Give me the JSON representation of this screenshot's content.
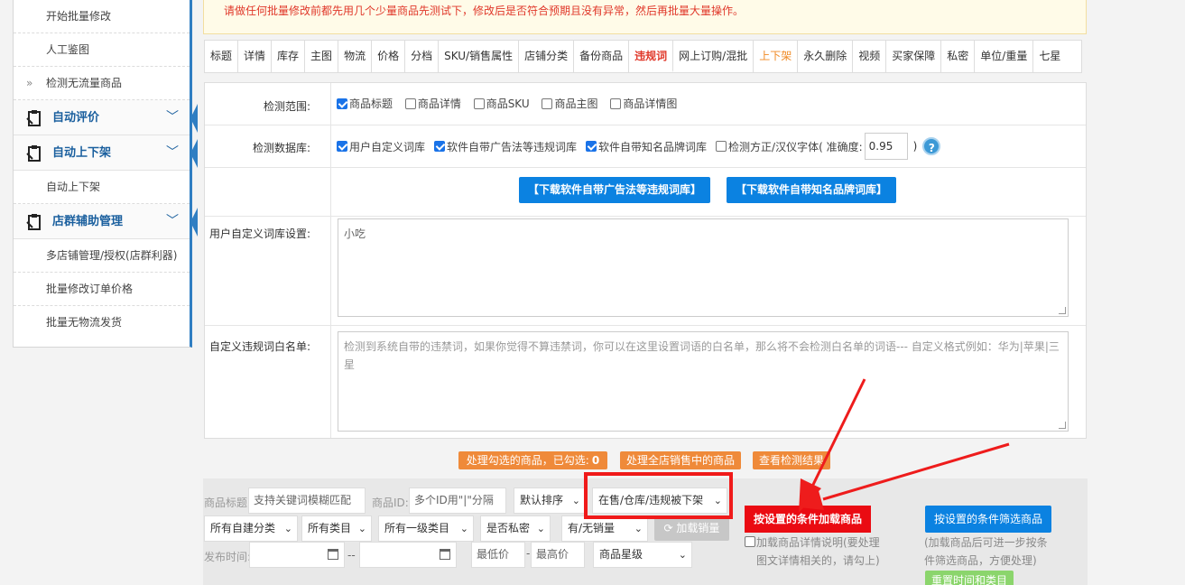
{
  "sidebar": {
    "items": [
      {
        "type": "sub",
        "label": "开始批量修改"
      },
      {
        "type": "sub",
        "label": "人工鉴图"
      },
      {
        "type": "sub",
        "label": "检测无流量商品",
        "chevron": "»"
      },
      {
        "type": "group",
        "label": "自动评价",
        "icon": "clipboard-icon"
      },
      {
        "type": "group",
        "label": "自动上下架",
        "icon": "clipboard-icon"
      },
      {
        "type": "sub",
        "label": "自动上下架"
      },
      {
        "type": "group",
        "label": "店群辅助管理",
        "icon": "clipboard-icon"
      },
      {
        "type": "sub",
        "label": "多店铺管理/授权(店群利器)"
      },
      {
        "type": "sub",
        "label": "批量修改订单价格"
      },
      {
        "type": "sub",
        "label": "批量无物流发货"
      }
    ]
  },
  "notice": "请做任何批量修改前都先用几个少量商品先测试下，修改后是否符合预期且没有异常，然后再批量大量操作。",
  "tabs": [
    {
      "label": "标题"
    },
    {
      "label": "详情"
    },
    {
      "label": "库存"
    },
    {
      "label": "主图"
    },
    {
      "label": "物流"
    },
    {
      "label": "价格"
    },
    {
      "label": "分档"
    },
    {
      "label": "SKU/销售属性"
    },
    {
      "label": "店铺分类"
    },
    {
      "label": "备份商品"
    },
    {
      "label": "违规词",
      "active": true
    },
    {
      "label": "网上订购/混批"
    },
    {
      "label": "上下架",
      "orange": true
    },
    {
      "label": "永久删除"
    },
    {
      "label": "视频"
    },
    {
      "label": "买家保障"
    },
    {
      "label": "私密"
    },
    {
      "label": "单位/重量"
    },
    {
      "label": "七星"
    }
  ],
  "form": {
    "scope": {
      "label": "检测范围:",
      "options": [
        {
          "label": "商品标题",
          "checked": true
        },
        {
          "label": "商品详情",
          "checked": false
        },
        {
          "label": "商品SKU",
          "checked": false
        },
        {
          "label": "商品主图",
          "checked": false
        },
        {
          "label": "商品详情图",
          "checked": false
        }
      ]
    },
    "database": {
      "label": "检测数据库:",
      "options": [
        {
          "label": "用户自定义词库",
          "checked": true
        },
        {
          "label": "软件自带广告法等违规词库",
          "checked": true
        },
        {
          "label": "软件自带知名品牌词库",
          "checked": true
        },
        {
          "label": "检测方正/汉仪字体( 准确度:",
          "checked": false
        }
      ],
      "accuracy": "0.95",
      "close_paren": ")",
      "help": "?"
    },
    "downloads": {
      "ad_lib": "【下载软件自带广告法等违规词库】",
      "brand_lib": "【下载软件自带知名品牌词库】"
    },
    "custom_lib": {
      "label": "用户自定义词库设置:",
      "value": "小吃"
    },
    "whitelist": {
      "label": "自定义违规词白名单:",
      "placeholder": "检测到系统自带的违禁词，如果你觉得不算违禁词，你可以在这里设置词语的白名单，那么将不会检测白名单的词语--- 自定义格式例如：华为|苹果|三星"
    }
  },
  "actions": {
    "process_selected": "处理勾选的商品，已勾选:",
    "selected_count": "0",
    "process_all": "处理全店销售中的商品",
    "view_results": "查看检测结果"
  },
  "filters": {
    "title_label": "商品标题:",
    "title_placeholder": "支持关键词模糊匹配",
    "id_label": "商品ID:",
    "id_placeholder": "多个ID用\"|\"分隔",
    "sort": "默认排序",
    "status": "在售/仓库/违规被下架",
    "cat_custom": "所有自建分类",
    "cat_all": "所有类目",
    "cat_level1": "所有一级类目",
    "is_private": "是否私密",
    "has_sales": "有/无销量",
    "load_sales": "加载销量",
    "time_label": "发布时间:",
    "time_sep": "--",
    "price_min": "最低价",
    "price_sep": "-",
    "price_max": "最高价",
    "star": "商品星级",
    "load_btn": "按设置的条件加载商品",
    "filter_btn": "按设置的条件筛选商品",
    "load_detail_note": "加载商品详情说明(要处理图文详情相关的，请勾上)",
    "filter_note": "(加载商品后可进一步按条件筛选商品，方便处理)",
    "reset_btn": "重置时间和类目"
  },
  "colors": {
    "accent_blue": "#0b82e1",
    "sidebar_blue": "#1a5f9e",
    "action_orange": "#ef8a3a",
    "danger_red": "#ea0b12",
    "green": "#8bd56c"
  }
}
